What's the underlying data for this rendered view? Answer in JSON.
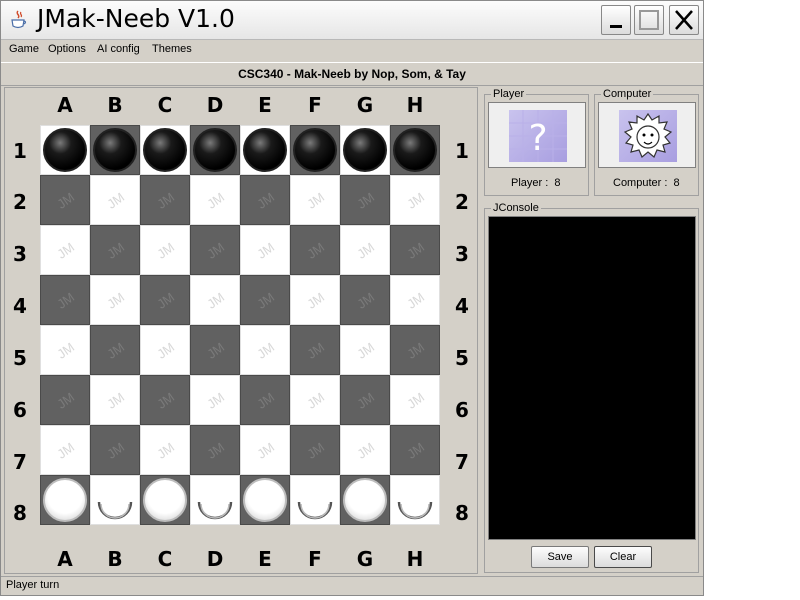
{
  "window": {
    "title": "JMak-Neeb V1.0"
  },
  "menu": [
    "Game",
    "Options",
    "AI config",
    "Themes"
  ],
  "subtitle": "CSC340 - Mak-Neeb by Nop, Som, & Tay",
  "board": {
    "columns": [
      "A",
      "B",
      "C",
      "D",
      "E",
      "F",
      "G",
      "H"
    ],
    "rows": [
      "1",
      "2",
      "3",
      "4",
      "5",
      "6",
      "7",
      "8"
    ],
    "watermark": "JM",
    "row1_pieces": [
      "black",
      "black",
      "black",
      "black",
      "black",
      "black",
      "black",
      "black"
    ],
    "row8_pieces": [
      "white",
      "hollow",
      "white",
      "hollow",
      "white",
      "hollow",
      "white",
      "hollow"
    ],
    "colors": {
      "dark": "#616161",
      "light": "#ffffff"
    }
  },
  "player": {
    "group_label": "Player",
    "avatar_glyph": "?",
    "score_text": "Player :  8"
  },
  "computer": {
    "group_label": "Computer",
    "score_text": "Computer :  8"
  },
  "console": {
    "group_label": "JConsole",
    "background": "#000000"
  },
  "buttons": {
    "save": "Save",
    "clear": "Clear"
  },
  "status": "Player turn"
}
